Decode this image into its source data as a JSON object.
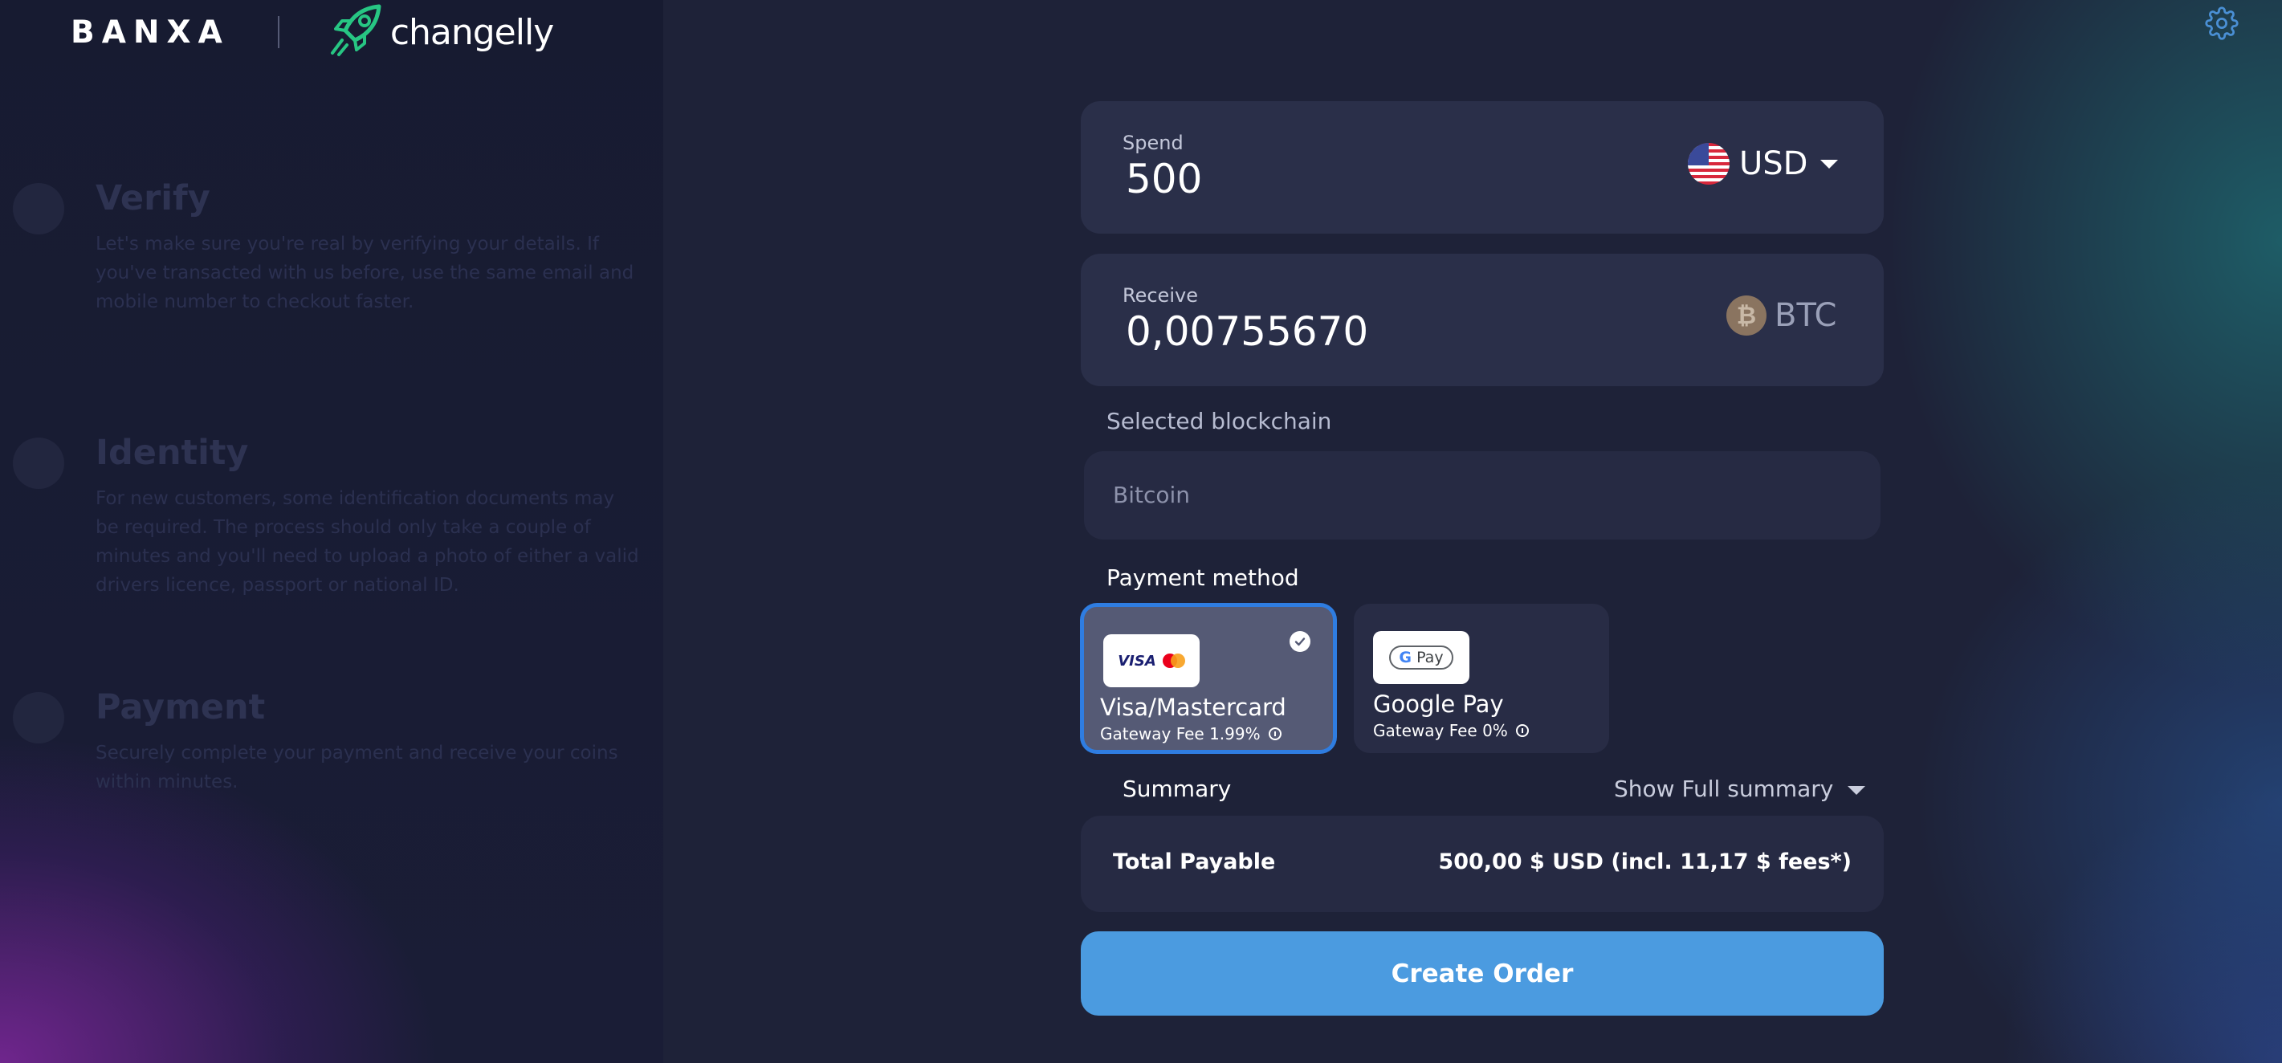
{
  "brand": {
    "banxa": "BANXA",
    "partner": "changelly"
  },
  "steps": [
    {
      "title": "Verify",
      "description": "Let's make sure you're real by verifying your details. If you've transacted with us before, use the same email and mobile number to checkout faster."
    },
    {
      "title": "Identity",
      "description": "For new customers, some identification documents may be required. The process should only take a couple of minutes and you'll need to upload a photo of either a valid drivers licence, passport or national ID."
    },
    {
      "title": "Payment",
      "description": "Securely complete your payment and receive your coins within minutes."
    }
  ],
  "spend": {
    "label": "Spend",
    "value": "500",
    "currency": "USD"
  },
  "receive": {
    "label": "Receive",
    "value": "0,00755670",
    "currency": "BTC"
  },
  "blockchain": {
    "label": "Selected blockchain",
    "value": "Bitcoin"
  },
  "payment": {
    "label": "Payment method",
    "methods": [
      {
        "name": "Visa/Mastercard",
        "fee": "Gateway Fee 1.99%",
        "selected": true,
        "logo": "visa-mastercard"
      },
      {
        "name": "Google Pay",
        "fee": "Gateway Fee 0%",
        "selected": false,
        "logo": "google-pay"
      }
    ]
  },
  "summary": {
    "label": "Summary",
    "toggle": "Show Full summary",
    "total_label": "Total Payable",
    "total_value": "500,00 $ USD (incl. 11,17 $ fees*)"
  },
  "cta": {
    "label": "Create Order"
  },
  "colors": {
    "accent": "#4b9be0",
    "card": "#2a2f49",
    "selected_border": "#2f7de1",
    "background": "#1d2137"
  }
}
